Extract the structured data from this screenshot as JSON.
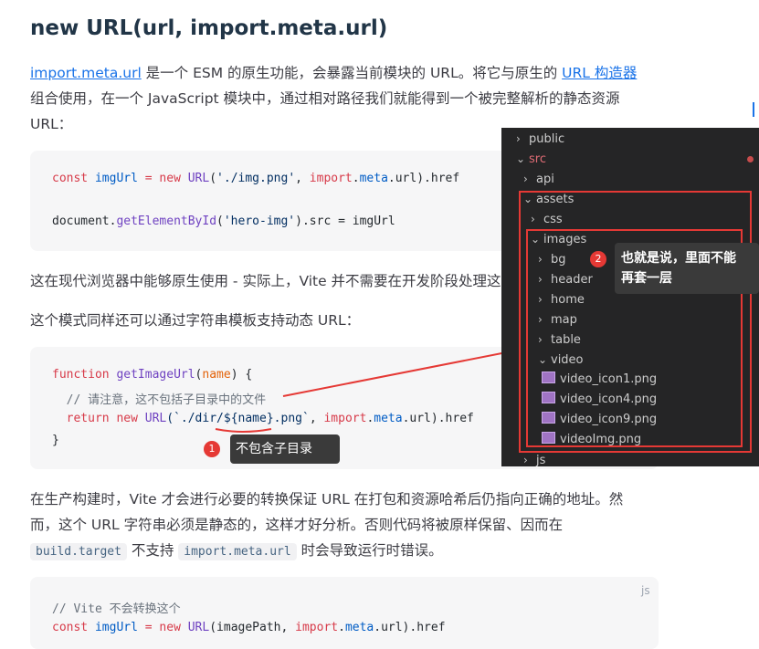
{
  "heading": "new URL(url, import.meta.url)",
  "para1": {
    "link1": "import.meta.url",
    "text1": " 是一个 ESM 的原生功能，会暴露当前模块的 URL。将它与原生的 ",
    "link2": "URL 构造器",
    "line2": "组合使用，在一个 JavaScript 模块中，通过相对路径我们就能得到一个被完整解析的静态资源",
    "line3": "URL："
  },
  "code1": {
    "l1a": "const ",
    "l1b": "imgUrl",
    "l1c": " = ",
    "l1d": "new ",
    "l1e": "URL",
    "l1f": "(",
    "l1g": "'./img.png'",
    "l1h": ", ",
    "l1i": "import",
    "l1j": ".",
    "l1k": "meta",
    "l1l": ".url).href",
    "l2a": "document.",
    "l2b": "getElementById",
    "l2c": "(",
    "l2d": "'hero-img'",
    "l2e": ").src = imgUrl"
  },
  "para2": "这在现代浏览器中能够原生使用 - 实际上，Vite 并不需要在开发阶段处理这",
  "para3": "这个模式同样还可以通过字符串模板支持动态 URL：",
  "code2": {
    "l1a": "function ",
    "l1b": "getImageUrl",
    "l1c": "(",
    "l1d": "name",
    "l1e": ") {",
    "l2": "  // 请注意，这不包括子目录中的文件",
    "l3a": "  return ",
    "l3b": "new ",
    "l3c": "URL",
    "l3d": "(`./dir/",
    "l3e": "${name}",
    "l3f": ".png`",
    "l3g": ", ",
    "l3h": "import",
    "l3i": ".",
    "l3j": "meta",
    "l3k": ".url).href",
    "l4": "}"
  },
  "annotation1": {
    "badge": "1",
    "text": "不包含子目录"
  },
  "annotation2": {
    "badge": "2",
    "line1": "也就是说，里面不能",
    "line2": "再套一层"
  },
  "para4": {
    "line1": "在生产构建时，Vite 才会进行必要的转换保证 URL 在打包和资源哈希后仍指向正确的地址。然",
    "line2": "而，这个 URL 字符串必须是静态的，这样才好分析。否则代码将被原样保留、因而在",
    "code_a": "build.target",
    "mid": " 不支持 ",
    "code_b": "import.meta.url",
    "end": " 时会导致运行时错误。"
  },
  "code3": {
    "lang": "js",
    "l1": "// Vite 不会转换这个",
    "l2a": "const ",
    "l2b": "imgUrl",
    "l2c": " = ",
    "l2d": "new ",
    "l2e": "URL",
    "l2f": "(imagePath, ",
    "l2g": "import",
    "l2h": ".",
    "l2i": "meta",
    "l2j": ".url).href"
  },
  "explorer": {
    "items": [
      {
        "label": "public",
        "chev": "›"
      },
      {
        "label": "src",
        "chev": "⌄"
      },
      {
        "label": "api",
        "chev": "›"
      },
      {
        "label": "assets",
        "chev": "⌄"
      },
      {
        "label": "css",
        "chev": "›"
      },
      {
        "label": "images",
        "chev": "⌄"
      },
      {
        "label": "bg",
        "chev": "›"
      },
      {
        "label": "header",
        "chev": "›"
      },
      {
        "label": "home",
        "chev": "›"
      },
      {
        "label": "map",
        "chev": "›"
      },
      {
        "label": "table",
        "chev": "›"
      },
      {
        "label": "video",
        "chev": "⌄"
      },
      {
        "label": "video_icon1.png"
      },
      {
        "label": "video_icon4.png"
      },
      {
        "label": "video_icon9.png"
      },
      {
        "label": "videoImg.png"
      },
      {
        "label": "js",
        "chev": "›"
      }
    ],
    "src_color": "#e06c75"
  }
}
